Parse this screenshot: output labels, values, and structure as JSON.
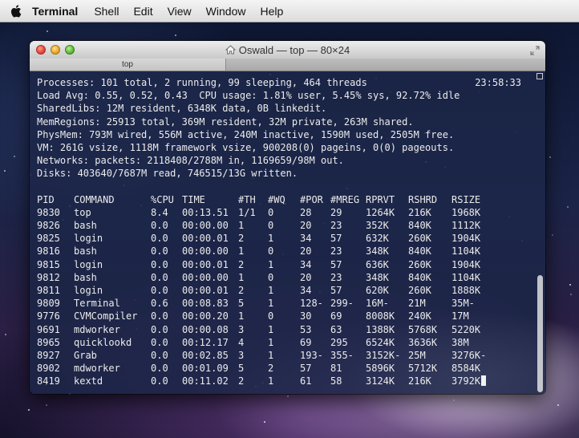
{
  "menubar": {
    "apple_icon": "apple-logo-icon",
    "app_name": "Terminal",
    "items": [
      "Shell",
      "Edit",
      "View",
      "Window",
      "Help"
    ]
  },
  "window": {
    "title": "Oswald — top — 80×24",
    "tab_label": "top",
    "title_icon": "home-folder-icon"
  },
  "terminal": {
    "clock": "23:58:33",
    "header_lines": [
      "Processes: 101 total, 2 running, 99 sleeping, 464 threads",
      "Load Avg: 0.55, 0.52, 0.43  CPU usage: 1.81% user, 5.45% sys, 92.72% idle",
      "SharedLibs: 12M resident, 6348K data, 0B linkedit.",
      "MemRegions: 25913 total, 369M resident, 32M private, 263M shared.",
      "PhysMem: 793M wired, 556M active, 240M inactive, 1590M used, 2505M free.",
      "VM: 261G vsize, 1118M framework vsize, 900208(0) pageins, 0(0) pageouts.",
      "Networks: packets: 2118408/2788M in, 1169659/98M out.",
      "Disks: 403640/7687M read, 746515/13G written."
    ],
    "columns": [
      "PID",
      "COMMAND",
      "%CPU",
      "TIME",
      "#TH",
      "#WQ",
      "#POR",
      "#MREG",
      "RPRVT",
      "RSHRD",
      "RSIZE"
    ],
    "rows": [
      [
        "9830",
        "top",
        "8.4",
        "00:13.51",
        "1/1",
        "0",
        "28",
        "29",
        "1264K",
        "216K",
        "1968K"
      ],
      [
        "9826",
        "bash",
        "0.0",
        "00:00.00",
        "1",
        "0",
        "20",
        "23",
        "352K",
        "840K",
        "1112K"
      ],
      [
        "9825",
        "login",
        "0.0",
        "00:00.01",
        "2",
        "1",
        "34",
        "57",
        "632K",
        "260K",
        "1904K"
      ],
      [
        "9816",
        "bash",
        "0.0",
        "00:00.00",
        "1",
        "0",
        "20",
        "23",
        "348K",
        "840K",
        "1104K"
      ],
      [
        "9815",
        "login",
        "0.0",
        "00:00.01",
        "2",
        "1",
        "34",
        "57",
        "636K",
        "260K",
        "1904K"
      ],
      [
        "9812",
        "bash",
        "0.0",
        "00:00.00",
        "1",
        "0",
        "20",
        "23",
        "348K",
        "840K",
        "1104K"
      ],
      [
        "9811",
        "login",
        "0.0",
        "00:00.01",
        "2",
        "1",
        "34",
        "57",
        "620K",
        "260K",
        "1888K"
      ],
      [
        "9809",
        "Terminal",
        "0.6",
        "00:08.83",
        "5",
        "1",
        "128-",
        "299-",
        "16M-",
        "21M",
        "35M-"
      ],
      [
        "9776",
        "CVMCompiler",
        "0.0",
        "00:00.20",
        "1",
        "0",
        "30",
        "69",
        "8008K",
        "240K",
        "17M"
      ],
      [
        "9691",
        "mdworker",
        "0.0",
        "00:00.08",
        "3",
        "1",
        "53",
        "63",
        "1388K",
        "5768K",
        "5220K"
      ],
      [
        "8965",
        "quicklookd",
        "0.0",
        "00:12.17",
        "4",
        "1",
        "69",
        "295",
        "6524K",
        "3636K",
        "38M"
      ],
      [
        "8927",
        "Grab",
        "0.0",
        "00:02.85",
        "3",
        "1",
        "193-",
        "355-",
        "3152K-",
        "25M",
        "3276K-"
      ],
      [
        "8902",
        "mdworker",
        "0.0",
        "00:01.09",
        "5",
        "2",
        "57",
        "81",
        "5896K",
        "5712K",
        "8584K"
      ],
      [
        "8419",
        "kextd",
        "0.0",
        "00:11.02",
        "2",
        "1",
        "61",
        "58",
        "3124K",
        "216K",
        "3792K"
      ]
    ]
  }
}
